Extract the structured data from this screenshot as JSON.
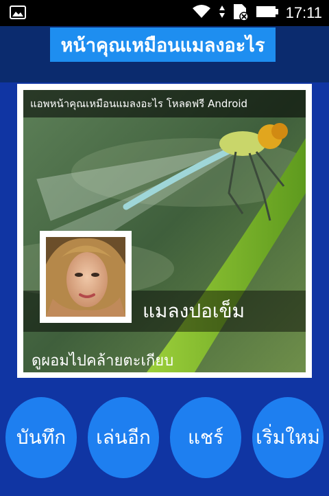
{
  "status_bar": {
    "time": "17:11",
    "icons": [
      "image-icon",
      "wifi-icon",
      "sim-off-icon",
      "battery-icon"
    ]
  },
  "header": {
    "title": "หน้าคุณเหมือนแมลงอะไร"
  },
  "result_card": {
    "caption": "แอพหน้าคุณเหมือนแมลงอะไร โหลดฟรี Android",
    "insect_name": "แมลงปอเข็ม",
    "description": "ดูผอมไปคล้ายตะเกียบ"
  },
  "actions": {
    "save": "บันทึก",
    "play_again": "เล่นอีก",
    "share": "แชร์",
    "restart": "เริ่มใหม่"
  },
  "colors": {
    "title_bg": "#1e8ef0",
    "button_bg": "#1e7ff0",
    "main_bg": "#1035a3",
    "header_bg": "#0b2b6e"
  }
}
